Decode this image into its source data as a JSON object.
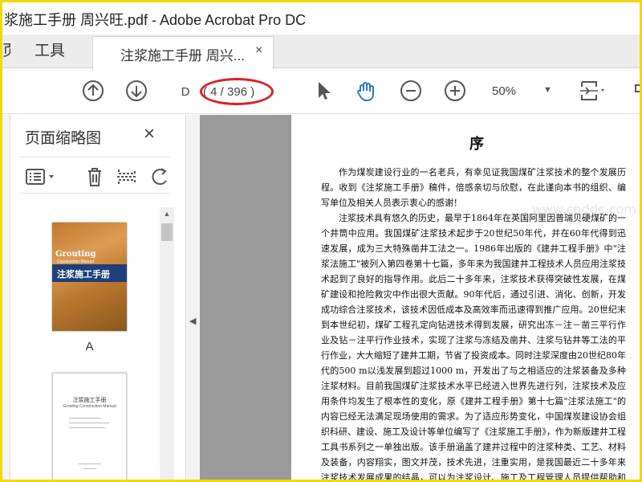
{
  "window": {
    "title": "浆施工手册  周兴旺.pdf - Adobe Acrobat Pro DC"
  },
  "tabs": {
    "home": "页",
    "tools": "工具",
    "document": "注浆施工手册  周兴...",
    "close": "×"
  },
  "toolbar": {
    "page_input": "D",
    "page_count": "( 4 / 396 )",
    "zoom": "50%",
    "zoom_caret": "▼"
  },
  "sidebar": {
    "title": "页面缩略图",
    "close": "×",
    "thumb1_label": "A",
    "cover": {
      "title_en": "Grouting",
      "subtitle_en": "Construction Manual",
      "title_cn": "注浆施工手册"
    },
    "thumb2": {
      "title_cn": "注浆施工手册",
      "title_en": "Grouting Construction Manual"
    }
  },
  "document": {
    "heading": "序",
    "paragraphs": [
      "作为煤炭建设行业的一名老兵，有幸见证我国煤矿注浆技术的整个发展历程。收到《注浆施工手册》稿件，倍感亲切与欣慰，在此谨向本书的组织、编写单位及相关人员表示衷心的感谢！",
      "注浆技术具有悠久的历史，最早于1864年在英国阿里因普瑞贝硬煤矿的一个井筒中应用。我国煤矿注浆技术起步于20世纪50年代，并在60年代得到迅速发展，成为三大特殊凿井工法之一。1986年出版的《建井工程手册》中\"注浆法施工\"被列入第四卷第十七篇，多年来为我国建井工程技术人员应用注浆技术起到了良好的指导作用。此后二十多年来，注浆技术获得突破性发展，在煤矿建设和抢险救灾中作出很大贡献。90年代后，通过引进、消化、创新，开发成功综合注浆技术，该技术因低成本及高效率而迅速得到推广应用。20世纪末到本世纪初，煤矿工程孔定向钻进技术得到发展，研究出冻－注－凿三平行作业及钻－注平行作业技术，实现了注浆与冻结及凿井、注浆与钻井等工法的平行作业，大大缩短了建井工期，节省了投资成本。同时注浆深度由20世纪80年代的500 m以浅发展到超过1000 m，开发出了与之相适应的注浆装备及多种注浆材料。目前我国煤矿注浆技术水平已经进入世界先进行列，注浆技术及应用条件均发生了根本性的变化，原《建井工程手册》第十七篇\"注浆法施工\"的内容已经无法满足现场使用的需求。为了适应形势变化，中国煤炭建设协会组织科研、建设、施工及设计等单位编写了《注浆施工手册》，作为新版建井工程工具书系列之一单独出版。该手册涵盖了建井过程中的注浆种类、工艺、材料及装备，内容翔实，图文并茂，技术先进，注重实用，是我国最近二十多年来注浆技术发展成果的结晶，可以为注浆设计、施工及工程管理人员提供帮助和参考。"
    ],
    "watermark": "www.cnddc.com"
  },
  "colors": {
    "highlight_oval": "#d8202a",
    "frame": "#f2d70a",
    "accent_blue": "#2a78c4"
  }
}
